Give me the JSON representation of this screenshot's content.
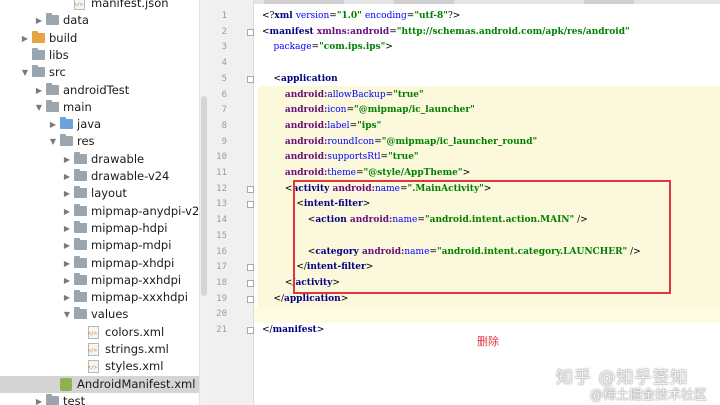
{
  "tree": {
    "items": [
      {
        "label": "manifest.json",
        "icon": "xml-file-icon",
        "indent": 5,
        "arrow": ""
      },
      {
        "label": "data",
        "icon": "folder-icon",
        "indent": 3,
        "arrow": "right"
      },
      {
        "label": "build",
        "icon": "folder-orange-icon",
        "indent": 2,
        "arrow": "right"
      },
      {
        "label": "libs",
        "icon": "folder-icon",
        "indent": 2,
        "arrow": ""
      },
      {
        "label": "src",
        "icon": "folder-icon",
        "indent": 2,
        "arrow": "down"
      },
      {
        "label": "androidTest",
        "icon": "folder-icon",
        "indent": 3,
        "arrow": "right"
      },
      {
        "label": "main",
        "icon": "folder-icon",
        "indent": 3,
        "arrow": "down"
      },
      {
        "label": "java",
        "icon": "folder-blue-icon",
        "indent": 4,
        "arrow": "right"
      },
      {
        "label": "res",
        "icon": "folder-icon",
        "indent": 4,
        "arrow": "down"
      },
      {
        "label": "drawable",
        "icon": "folder-icon",
        "indent": 5,
        "arrow": "right"
      },
      {
        "label": "drawable-v24",
        "icon": "folder-icon",
        "indent": 5,
        "arrow": "right"
      },
      {
        "label": "layout",
        "icon": "folder-icon",
        "indent": 5,
        "arrow": "right"
      },
      {
        "label": "mipmap-anydpi-v26",
        "icon": "folder-icon",
        "indent": 5,
        "arrow": "right"
      },
      {
        "label": "mipmap-hdpi",
        "icon": "folder-icon",
        "indent": 5,
        "arrow": "right"
      },
      {
        "label": "mipmap-mdpi",
        "icon": "folder-icon",
        "indent": 5,
        "arrow": "right"
      },
      {
        "label": "mipmap-xhdpi",
        "icon": "folder-icon",
        "indent": 5,
        "arrow": "right"
      },
      {
        "label": "mipmap-xxhdpi",
        "icon": "folder-icon",
        "indent": 5,
        "arrow": "right"
      },
      {
        "label": "mipmap-xxxhdpi",
        "icon": "folder-icon",
        "indent": 5,
        "arrow": "right"
      },
      {
        "label": "values",
        "icon": "folder-icon",
        "indent": 5,
        "arrow": "down"
      },
      {
        "label": "colors.xml",
        "icon": "xml-file-icon",
        "indent": 6,
        "arrow": ""
      },
      {
        "label": "strings.xml",
        "icon": "xml-file-icon",
        "indent": 6,
        "arrow": ""
      },
      {
        "label": "styles.xml",
        "icon": "xml-file-icon",
        "indent": 6,
        "arrow": ""
      },
      {
        "label": "AndroidManifest.xml",
        "icon": "manifest-file-icon",
        "indent": 4,
        "arrow": "",
        "selected": true
      },
      {
        "label": "test",
        "icon": "folder-icon",
        "indent": 3,
        "arrow": "right"
      }
    ]
  },
  "editor": {
    "line_numbers": [
      "1",
      "2",
      "3",
      "4",
      "5",
      "6",
      "7",
      "8",
      "9",
      "10",
      "11",
      "12",
      "13",
      "14",
      "15",
      "16",
      "17",
      "18",
      "19",
      "20",
      "21"
    ],
    "lines": [
      [
        {
          "c": "br",
          "t": "<?"
        },
        {
          "c": "tag",
          "t": "xml "
        },
        {
          "c": "an",
          "t": "version"
        },
        {
          "c": "br",
          "t": "="
        },
        {
          "c": "av",
          "t": "\"1.0\" "
        },
        {
          "c": "an",
          "t": "encoding"
        },
        {
          "c": "br",
          "t": "="
        },
        {
          "c": "av",
          "t": "\"utf-8\""
        },
        {
          "c": "br",
          "t": "?>"
        }
      ],
      [
        {
          "c": "br",
          "t": "<"
        },
        {
          "c": "tag",
          "t": "manifest "
        },
        {
          "c": "ns",
          "t": "xmlns:android"
        },
        {
          "c": "br",
          "t": "="
        },
        {
          "c": "av",
          "t": "\"http://schemas.android.com/apk/res/android\""
        }
      ],
      [
        {
          "c": "br",
          "t": "    "
        },
        {
          "c": "an",
          "t": "package"
        },
        {
          "c": "br",
          "t": "="
        },
        {
          "c": "av",
          "t": "\"com.ips.ips\""
        },
        {
          "c": "br",
          "t": ">"
        }
      ],
      [],
      [
        {
          "c": "br",
          "t": "    <"
        },
        {
          "c": "tag",
          "t": "application"
        }
      ],
      [
        {
          "c": "br",
          "t": "        "
        },
        {
          "c": "ns",
          "t": "android:"
        },
        {
          "c": "an",
          "t": "allowBackup"
        },
        {
          "c": "br",
          "t": "="
        },
        {
          "c": "av",
          "t": "\"true\""
        }
      ],
      [
        {
          "c": "br",
          "t": "        "
        },
        {
          "c": "ns",
          "t": "android:"
        },
        {
          "c": "an",
          "t": "icon"
        },
        {
          "c": "br",
          "t": "="
        },
        {
          "c": "av",
          "t": "\"@mipmap/ic_launcher\""
        }
      ],
      [
        {
          "c": "br",
          "t": "        "
        },
        {
          "c": "ns",
          "t": "android:"
        },
        {
          "c": "an",
          "t": "label"
        },
        {
          "c": "br",
          "t": "="
        },
        {
          "c": "av",
          "t": "\"ips\""
        }
      ],
      [
        {
          "c": "br",
          "t": "        "
        },
        {
          "c": "ns",
          "t": "android:"
        },
        {
          "c": "an",
          "t": "roundIcon"
        },
        {
          "c": "br",
          "t": "="
        },
        {
          "c": "av",
          "t": "\"@mipmap/ic_launcher_round\""
        }
      ],
      [
        {
          "c": "br",
          "t": "        "
        },
        {
          "c": "ns",
          "t": "android:"
        },
        {
          "c": "an",
          "t": "supportsRtl"
        },
        {
          "c": "br",
          "t": "="
        },
        {
          "c": "av",
          "t": "\"true\""
        }
      ],
      [
        {
          "c": "br",
          "t": "        "
        },
        {
          "c": "ns",
          "t": "android:"
        },
        {
          "c": "an",
          "t": "theme"
        },
        {
          "c": "br",
          "t": "="
        },
        {
          "c": "av",
          "t": "\"@style/AppTheme\""
        },
        {
          "c": "br",
          "t": ">"
        }
      ],
      [
        {
          "c": "br",
          "t": "        <"
        },
        {
          "c": "tag",
          "t": "activity "
        },
        {
          "c": "ns",
          "t": "android:"
        },
        {
          "c": "an",
          "t": "name"
        },
        {
          "c": "br",
          "t": "="
        },
        {
          "c": "av",
          "t": "\".MainActivity\""
        },
        {
          "c": "br",
          "t": ">"
        }
      ],
      [
        {
          "c": "br",
          "t": "            <"
        },
        {
          "c": "tag",
          "t": "intent-filter"
        },
        {
          "c": "br",
          "t": ">"
        }
      ],
      [
        {
          "c": "br",
          "t": "                <"
        },
        {
          "c": "tag",
          "t": "action "
        },
        {
          "c": "ns",
          "t": "android:"
        },
        {
          "c": "an",
          "t": "name"
        },
        {
          "c": "br",
          "t": "="
        },
        {
          "c": "av",
          "t": "\"android.intent.action.MAIN\""
        },
        {
          "c": "br",
          "t": " />"
        }
      ],
      [],
      [
        {
          "c": "br",
          "t": "                <"
        },
        {
          "c": "tag",
          "t": "category "
        },
        {
          "c": "ns",
          "t": "android:"
        },
        {
          "c": "an",
          "t": "name"
        },
        {
          "c": "br",
          "t": "="
        },
        {
          "c": "av",
          "t": "\"android.intent.category.LAUNCHER\""
        },
        {
          "c": "br",
          "t": " />"
        }
      ],
      [
        {
          "c": "br",
          "t": "            </"
        },
        {
          "c": "tag",
          "t": "intent-filter"
        },
        {
          "c": "br",
          "t": ">"
        }
      ],
      [
        {
          "c": "br",
          "t": "        </"
        },
        {
          "c": "tag",
          "t": "activity"
        },
        {
          "c": "br",
          "t": ">"
        }
      ],
      [
        {
          "c": "br",
          "t": "    </"
        },
        {
          "c": "tag",
          "t": "application"
        },
        {
          "c": "br",
          "t": ">"
        }
      ],
      [],
      [
        {
          "c": "br",
          "t": "</"
        },
        {
          "c": "tag",
          "t": "manifest"
        },
        {
          "c": "br",
          "t": ">"
        }
      ]
    ]
  },
  "annotation": {
    "delete_label": "删除",
    "box_color": "#e2353e"
  },
  "watermark": {
    "line1": "知乎 @知乎签知",
    "line2": "@稀土掘金技术社区"
  }
}
